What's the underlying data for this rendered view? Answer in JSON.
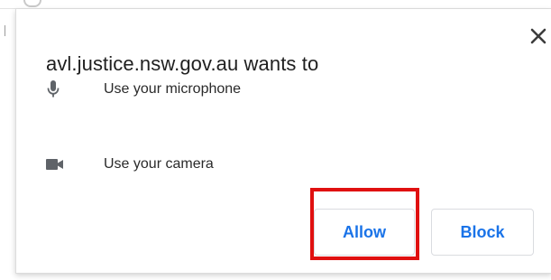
{
  "dialog": {
    "title": "avl.justice.nsw.gov.au wants to",
    "permissions": [
      {
        "icon": "microphone-icon",
        "label": "Use your microphone"
      },
      {
        "icon": "camera-icon",
        "label": "Use your camera"
      }
    ],
    "buttons": {
      "allow_label": "Allow",
      "block_label": "Block"
    }
  },
  "colors": {
    "accent": "#1a73e8",
    "highlight": "#e01010",
    "icon": "#5f6368",
    "text": "#1f1f1f"
  }
}
